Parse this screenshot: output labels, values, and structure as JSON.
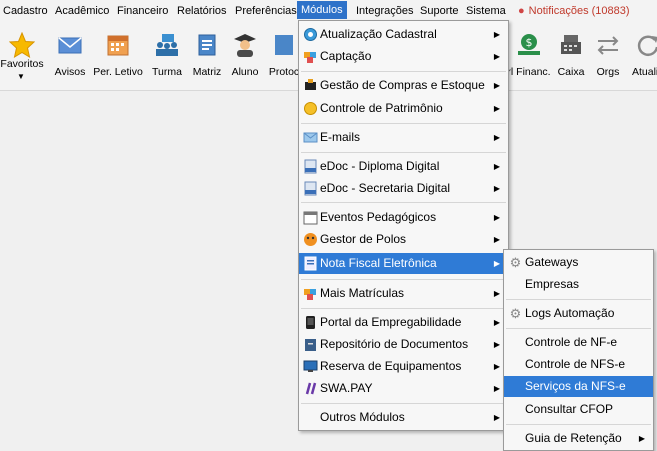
{
  "menubar": {
    "items": [
      "Cadastro",
      "Acadêmico",
      "Financeiro",
      "Relatórios",
      "Preferências",
      "Módulos",
      "Integrações",
      "Suporte",
      "Sistema"
    ],
    "notifications": "Notificações (10883)"
  },
  "toolbar": {
    "buttons": [
      "Favoritos",
      "Avisos",
      "Per. Letivo",
      "Turma",
      "Matriz",
      "Aluno",
      "Protoc",
      "rl Financ.",
      "Caixa",
      "Orgs",
      "Atuali"
    ]
  },
  "modulos_menu": {
    "items": [
      {
        "label": "Atualização Cadastral",
        "icon": "update-icon"
      },
      {
        "label": "Captação",
        "icon": "puzzle-icon"
      },
      {
        "label": "Gestão de Compras e Estoque",
        "icon": "purchase-icon"
      },
      {
        "label": "Controle de Patrimônio",
        "icon": "asset-icon"
      },
      {
        "label": "E-mails",
        "icon": "email-icon"
      },
      {
        "label": "eDoc - Diploma Digital",
        "icon": "edoc-icon"
      },
      {
        "label": "eDoc - Secretaria Digital",
        "icon": "edoc-icon"
      },
      {
        "label": "Eventos Pedagógicos",
        "icon": "calendar-icon"
      },
      {
        "label": "Gestor de Polos",
        "icon": "poles-icon"
      },
      {
        "label": "Nota Fiscal Eletrônica",
        "icon": "invoice-icon"
      },
      {
        "label": "Mais Matrículas",
        "icon": "puzzle-icon"
      },
      {
        "label": "Portal da Empregabilidade",
        "icon": "phone-icon"
      },
      {
        "label": "Repositório de Documentos",
        "icon": "archive-icon"
      },
      {
        "label": "Reserva de Equipamentos",
        "icon": "monitor-icon"
      },
      {
        "label": "SWA.PAY",
        "icon": "pay-icon"
      },
      {
        "label": "Outros Módulos",
        "icon": ""
      }
    ]
  },
  "nfe_submenu": {
    "items": [
      {
        "label": "Gateways",
        "icon": "gear-icon"
      },
      {
        "label": "Empresas",
        "icon": ""
      },
      {
        "label": "Logs Automação",
        "icon": "gear-icon"
      },
      {
        "label": "Controle de NF-e",
        "icon": ""
      },
      {
        "label": "Controle de NFS-e",
        "icon": ""
      },
      {
        "label": "Serviços da NFS-e",
        "icon": ""
      },
      {
        "label": "Consultar CFOP",
        "icon": ""
      },
      {
        "label": "Guia de Retenção",
        "icon": ""
      }
    ]
  }
}
